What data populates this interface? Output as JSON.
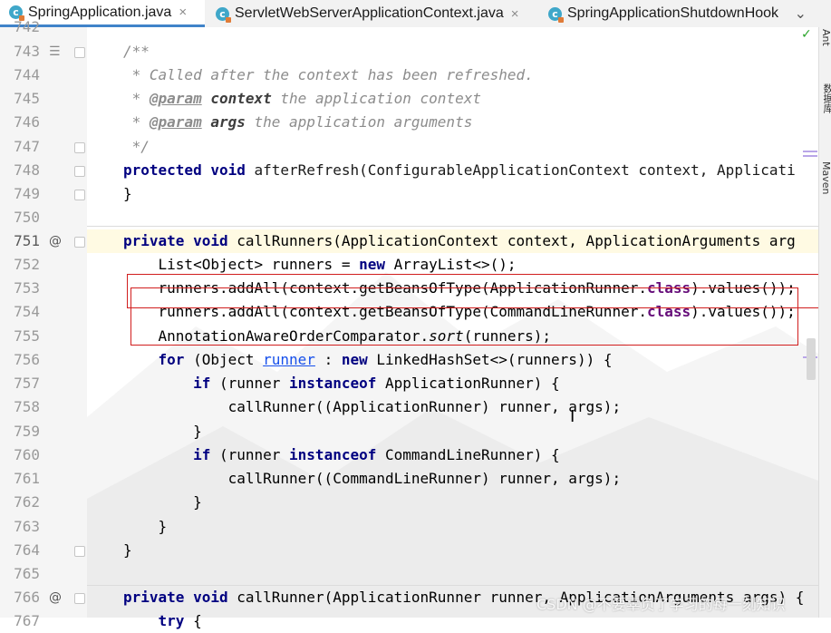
{
  "tabs": [
    {
      "label": "SpringApplication.java",
      "icon": "class-icon",
      "close": "×",
      "active": true
    },
    {
      "label": "ServletWebServerApplicationContext.java",
      "icon": "class-icon",
      "close": "×",
      "active": false
    },
    {
      "label": "SpringApplicationShutdownHook",
      "icon": "class-icon",
      "close": "",
      "active": false
    }
  ],
  "tabs_menu_icon": "⌄",
  "right_panel": {
    "ant_label": "Ant",
    "database_label": "数据库",
    "maven_label": "Maven",
    "inspection_icon": "✓"
  },
  "editor": {
    "current_line": "751",
    "accent_color": "#000080",
    "lines": [
      {
        "n": "742",
        "text": ""
      },
      {
        "n": "743",
        "text": "/**"
      },
      {
        "n": "744",
        "text": " * Called after the context has been refreshed."
      },
      {
        "n": "745",
        "text": " * @param context the application context"
      },
      {
        "n": "746",
        "text": " * @param args the application arguments"
      },
      {
        "n": "747",
        "text": " */"
      },
      {
        "n": "748",
        "text": "protected void afterRefresh(ConfigurableApplicationContext context, Applicati"
      },
      {
        "n": "749",
        "text": "}"
      },
      {
        "n": "750",
        "text": ""
      },
      {
        "n": "751",
        "text": "private void callRunners(ApplicationContext context, ApplicationArguments arg"
      },
      {
        "n": "752",
        "text": "    List<Object> runners = new ArrayList<>();"
      },
      {
        "n": "753",
        "text": "    runners.addAll(context.getBeansOfType(ApplicationRunner.class).values());"
      },
      {
        "n": "754",
        "text": "    runners.addAll(context.getBeansOfType(CommandLineRunner.class).values());"
      },
      {
        "n": "755",
        "text": "    AnnotationAwareOrderComparator.sort(runners);"
      },
      {
        "n": "756",
        "text": "    for (Object runner : new LinkedHashSet<>(runners)) {"
      },
      {
        "n": "757",
        "text": "        if (runner instanceof ApplicationRunner) {"
      },
      {
        "n": "758",
        "text": "            callRunner((ApplicationRunner) runner, args);"
      },
      {
        "n": "759",
        "text": "        }"
      },
      {
        "n": "760",
        "text": "        if (runner instanceof CommandLineRunner) {"
      },
      {
        "n": "761",
        "text": "            callRunner((CommandLineRunner) runner, args);"
      },
      {
        "n": "762",
        "text": "        }"
      },
      {
        "n": "763",
        "text": "    }"
      },
      {
        "n": "764",
        "text": "}"
      },
      {
        "n": "765",
        "text": ""
      },
      {
        "n": "766",
        "text": "private void callRunner(ApplicationRunner runner, ApplicationArguments args) {"
      },
      {
        "n": "767",
        "text": "    try {"
      }
    ]
  },
  "watermark": "CSDN @不要辜负了学习的每一刻知识"
}
